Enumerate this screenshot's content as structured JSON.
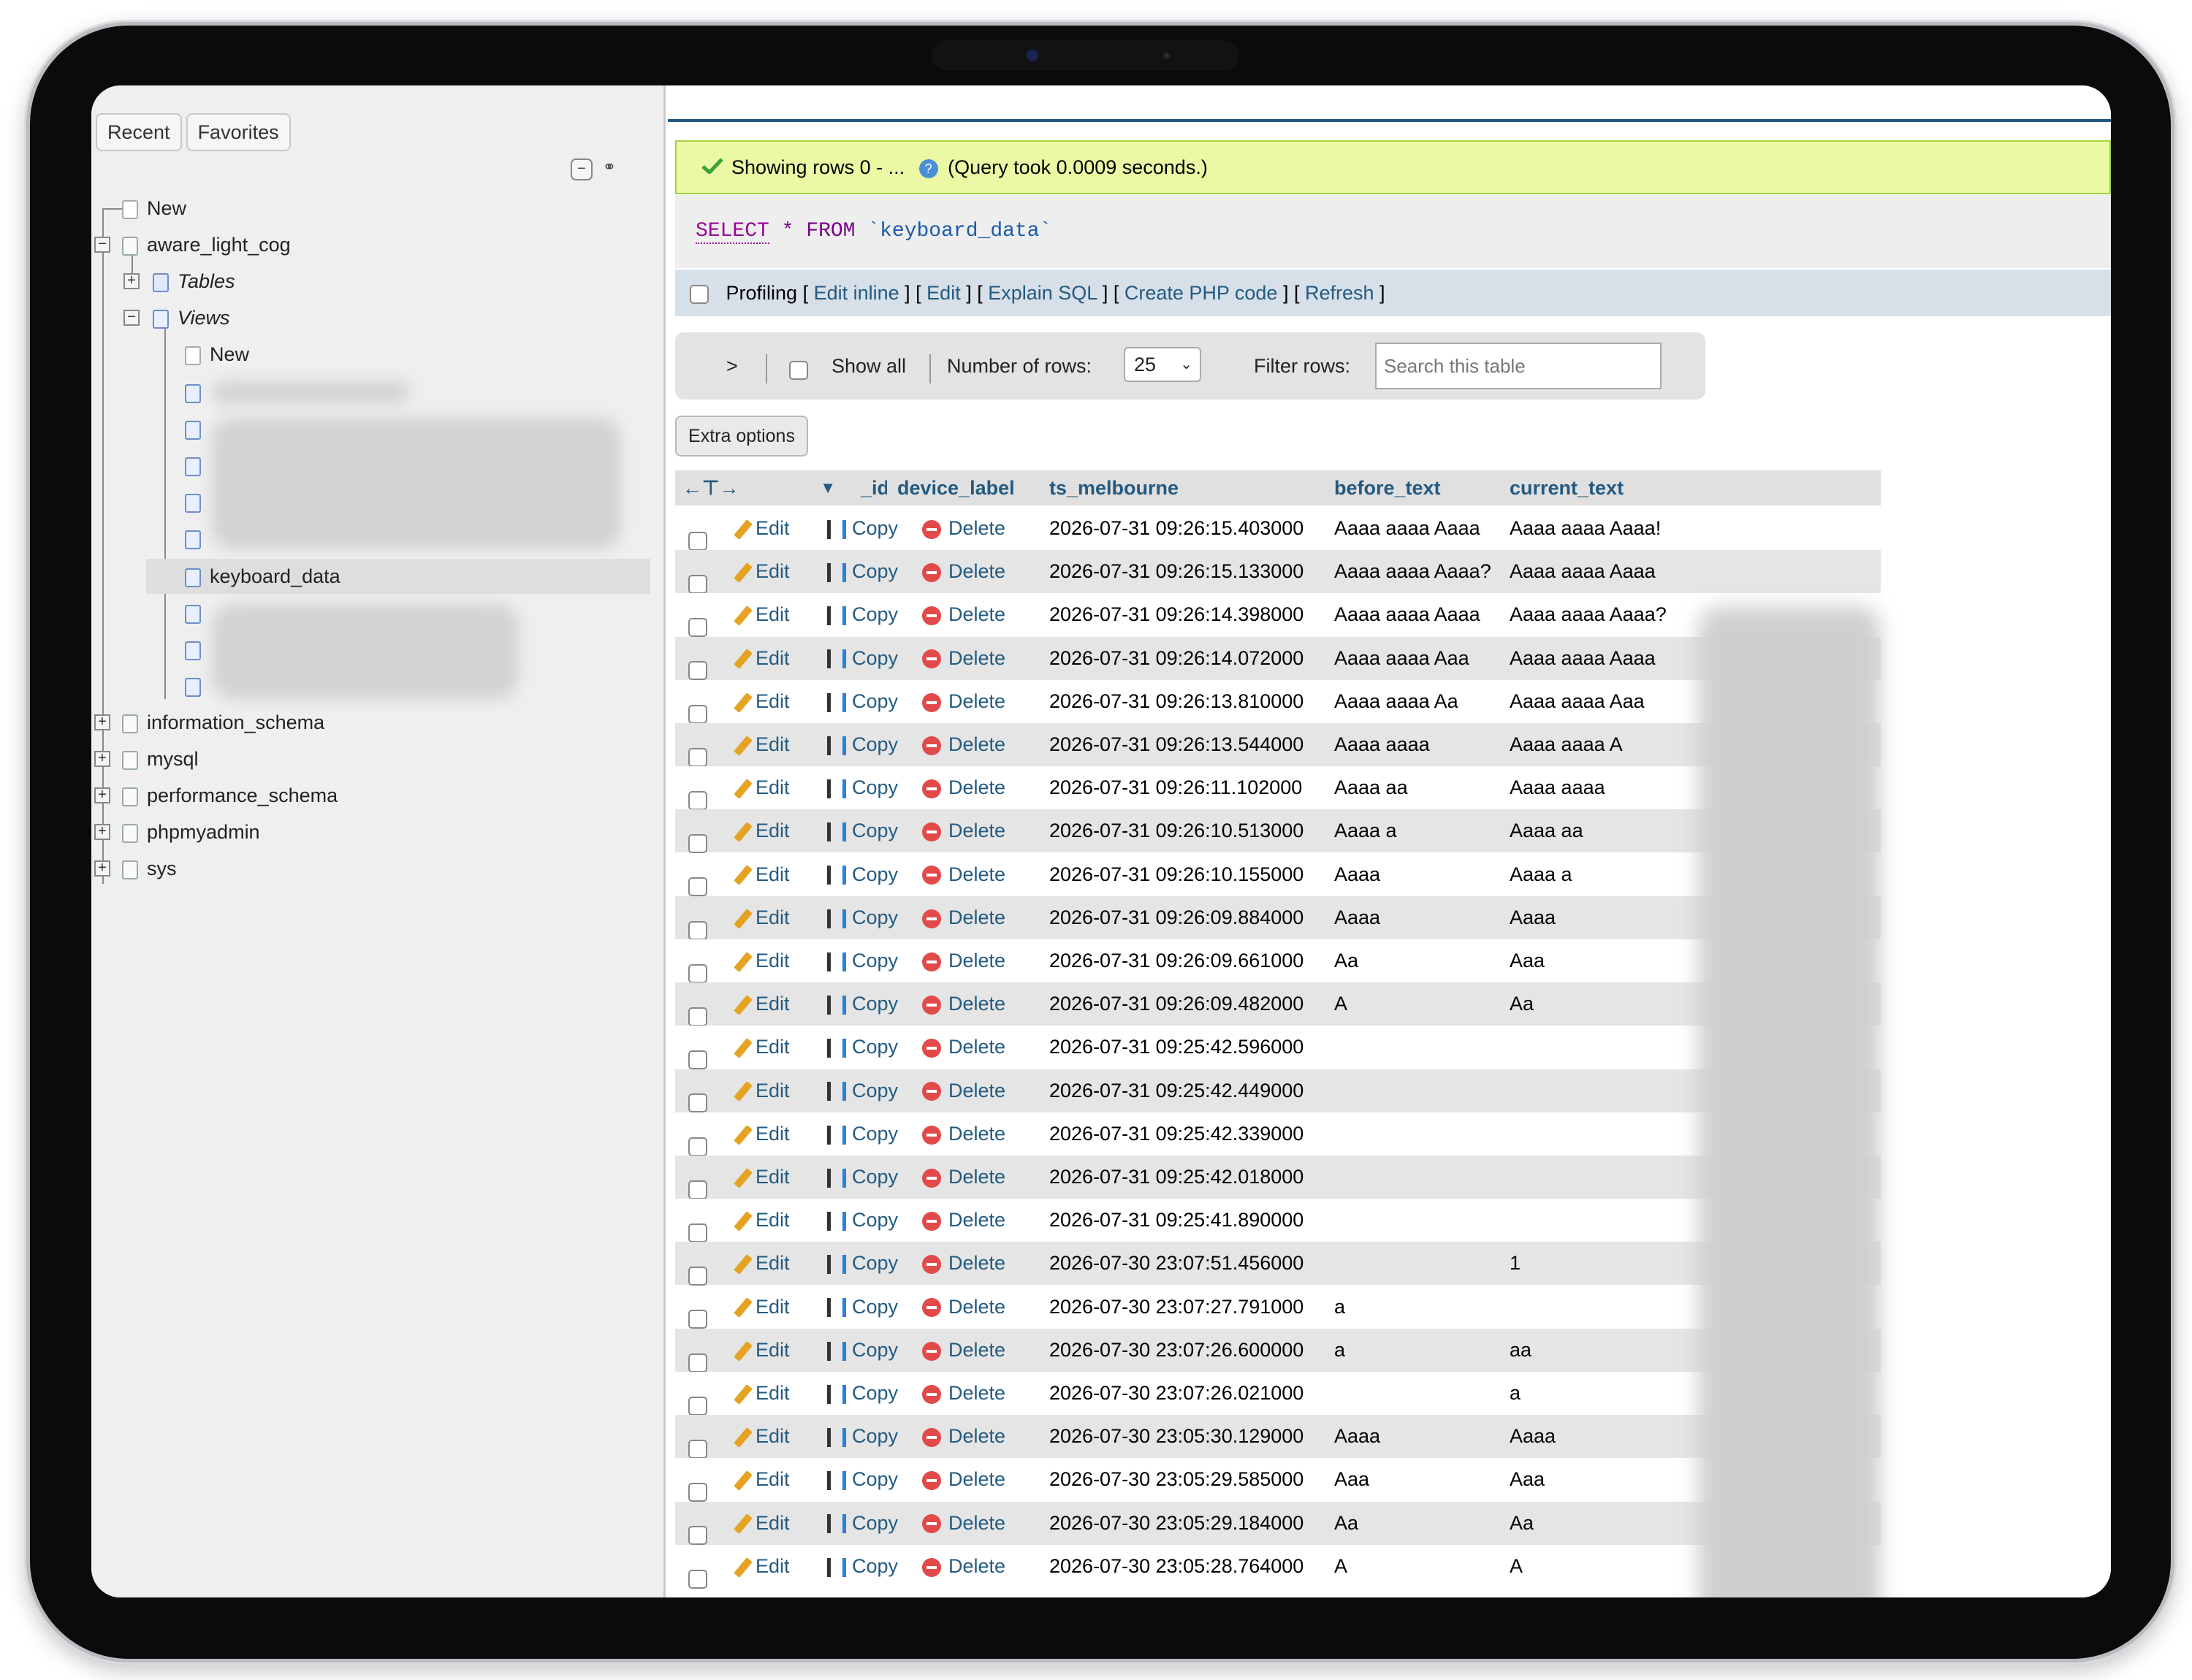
{
  "sidebar": {
    "tabs": [
      "Recent",
      "Favorites"
    ],
    "items": {
      "new_root": "New",
      "db_main": "aware_light_cog",
      "tables": "Tables",
      "views": "Views",
      "views_new": "New",
      "selected_view": "keyboard_data",
      "db_info": "information_schema",
      "db_mysql": "mysql",
      "db_perf": "performance_schema",
      "db_pma": "phpmyadmin",
      "db_sys": "sys"
    }
  },
  "result": {
    "message": "Showing rows 0 - ...",
    "query_time": "(Query took 0.0009 seconds.)",
    "sql": {
      "select": "SELECT",
      "star": "*",
      "from": "FROM",
      "table": "`keyboard_data`"
    }
  },
  "profiling": {
    "label": "Profiling",
    "links": [
      "Edit inline",
      "Edit",
      "Explain SQL",
      "Create PHP code",
      "Refresh"
    ]
  },
  "navigation": {
    "next": ">",
    "show_all": "Show all",
    "rows_label": "Number of rows:",
    "rows_value": "25",
    "filter_label": "Filter rows:",
    "filter_placeholder": "Search this table"
  },
  "extra_options": "Extra options",
  "table": {
    "columns": [
      "_id",
      "device_label",
      "ts_melbourne",
      "before_text",
      "current_text"
    ],
    "actions": {
      "edit": "Edit",
      "copy": "Copy",
      "delete": "Delete"
    },
    "rows": [
      {
        "ts": "2026-07-31 09:26:15.403000",
        "before": "Aaaa aaaa Aaaa",
        "current": "Aaaa aaaa Aaaa!"
      },
      {
        "ts": "2026-07-31 09:26:15.133000",
        "before": "Aaaa aaaa Aaaa?",
        "current": "Aaaa aaaa Aaaa"
      },
      {
        "ts": "2026-07-31 09:26:14.398000",
        "before": "Aaaa aaaa Aaaa",
        "current": "Aaaa aaaa Aaaa?"
      },
      {
        "ts": "2026-07-31 09:26:14.072000",
        "before": "Aaaa aaaa Aaa",
        "current": "Aaaa aaaa Aaaa"
      },
      {
        "ts": "2026-07-31 09:26:13.810000",
        "before": "Aaaa aaaa Aa",
        "current": "Aaaa aaaa Aaa"
      },
      {
        "ts": "2026-07-31 09:26:13.544000",
        "before": "Aaaa aaaa",
        "current": "Aaaa aaaa A"
      },
      {
        "ts": "2026-07-31 09:26:11.102000",
        "before": "Aaaa aa",
        "current": "Aaaa aaaa"
      },
      {
        "ts": "2026-07-31 09:26:10.513000",
        "before": "Aaaa a",
        "current": "Aaaa aa"
      },
      {
        "ts": "2026-07-31 09:26:10.155000",
        "before": "Aaaa",
        "current": "Aaaa a"
      },
      {
        "ts": "2026-07-31 09:26:09.884000",
        "before": "Aaaa",
        "current": "Aaaa"
      },
      {
        "ts": "2026-07-31 09:26:09.661000",
        "before": "Aa",
        "current": "Aaa"
      },
      {
        "ts": "2026-07-31 09:26:09.482000",
        "before": "A",
        "current": "Aa"
      },
      {
        "ts": "2026-07-31 09:25:42.596000",
        "before": "",
        "current": ""
      },
      {
        "ts": "2026-07-31 09:25:42.449000",
        "before": "",
        "current": ""
      },
      {
        "ts": "2026-07-31 09:25:42.339000",
        "before": "",
        "current": ""
      },
      {
        "ts": "2026-07-31 09:25:42.018000",
        "before": "",
        "current": ""
      },
      {
        "ts": "2026-07-31 09:25:41.890000",
        "before": "",
        "current": ""
      },
      {
        "ts": "2026-07-30 23:07:51.456000",
        "before": "",
        "current": "1"
      },
      {
        "ts": "2026-07-30 23:07:27.791000",
        "before": "a",
        "current": ""
      },
      {
        "ts": "2026-07-30 23:07:26.600000",
        "before": "a",
        "current": "aa"
      },
      {
        "ts": "2026-07-30 23:07:26.021000",
        "before": "",
        "current": "a"
      },
      {
        "ts": "2026-07-30 23:05:30.129000",
        "before": "Aaaa",
        "current": "Aaaa"
      },
      {
        "ts": "2026-07-30 23:05:29.585000",
        "before": "Aaa",
        "current": "Aaa"
      },
      {
        "ts": "2026-07-30 23:05:29.184000",
        "before": "Aa",
        "current": "Aa"
      },
      {
        "ts": "2026-07-30 23:05:28.764000",
        "before": "A",
        "current": "A"
      }
    ]
  }
}
